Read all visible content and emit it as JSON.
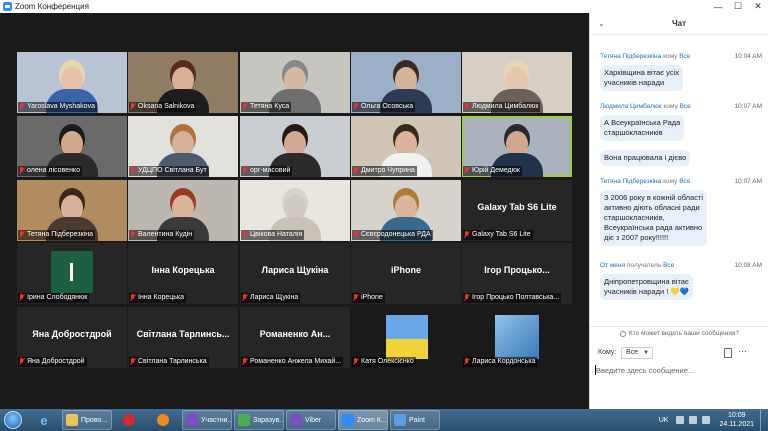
{
  "window": {
    "title": "Zoom Конференция",
    "controls": [
      "—",
      "☐",
      "✕"
    ]
  },
  "participants": [
    {
      "name": "Yaroslava Myshakova",
      "video": true,
      "muted": true,
      "bg": "#b8c3d4",
      "skin": "#e8c2a8",
      "shirt": "#3a63a8",
      "hair": "#e8d8a8"
    },
    {
      "name": "Oksana Salnikova",
      "video": true,
      "muted": true,
      "bg": "#8f7c62",
      "skin": "#d8b096",
      "shirt": "#1d1d1d",
      "hair": "#5a2b1a"
    },
    {
      "name": "Тетяна Куса",
      "video": true,
      "muted": true,
      "bg": "#c7c5c0",
      "skin": "#d4b8a4",
      "shirt": "#6e6e6e",
      "hair": "#888"
    },
    {
      "name": "Ольга Осовська",
      "video": true,
      "muted": true,
      "bg": "#9bb0c6",
      "skin": "#d5b39b",
      "shirt": "#2d3b55",
      "hair": "#3b2a22"
    },
    {
      "name": "Людмила Цимбалюк",
      "video": true,
      "muted": true,
      "bg": "#d8cfc4",
      "skin": "#e6c6ae",
      "shirt": "#6a6058",
      "hair": "#e4d6b8"
    },
    {
      "name": "олена лісовенко",
      "video": true,
      "muted": true,
      "bg": "#6a6a6a",
      "skin": "#d1a88c",
      "shirt": "#2a2a2a",
      "hair": "#1a1a1a"
    },
    {
      "name": "УДЦПО Світлана Бут",
      "video": true,
      "muted": true,
      "bg": "#e3e1dc",
      "skin": "#d5b09a",
      "shirt": "#4e5a6e",
      "hair": "#b07040"
    },
    {
      "name": "орг-масовий",
      "video": true,
      "muted": true,
      "bg": "#c9cdd2",
      "skin": "#d3a994",
      "shirt": "#2b2b2b",
      "hair": "#241812"
    },
    {
      "name": "Дмитро Чуприна",
      "video": true,
      "muted": true,
      "bg": "#cfc6b7",
      "skin": "#d9b49a",
      "shirt": "#f0f0f0",
      "hair": "#3a2a1e"
    },
    {
      "name": "Юрій Демедюк",
      "video": true,
      "muted": false,
      "speaking": true,
      "bg": "#a9b2bd",
      "skin": "#d2a790",
      "shirt": "#22324a",
      "hair": "#2a2a2a"
    },
    {
      "name": "Тетяна Підберезкіна",
      "video": true,
      "muted": true,
      "bg": "#b08c5e",
      "skin": "#d7b29a",
      "shirt": "#4a3b2e",
      "hair": "#3a281c"
    },
    {
      "name": "Валентина Кудін",
      "video": true,
      "muted": true,
      "bg": "#bcb7b0",
      "skin": "#d9b39a",
      "shirt": "#3a3a3a",
      "hair": "#9a3a22"
    },
    {
      "name": "Цвікова Наталія",
      "video": true,
      "muted": true,
      "bg": "#e9e6e0",
      "skin": "#cfcac2",
      "shirt": "#c8c2b8",
      "hair": "#d8d2c8"
    },
    {
      "name": "Сєвєродонецька РДА",
      "video": true,
      "muted": true,
      "bg": "#d6d2cc",
      "skin": "#dcb69c",
      "shirt": "#3a6a8a",
      "hair": "#b07a3a"
    },
    {
      "name": "Galaxy Tab S6 Lite",
      "display": "Galaxy Tab S6 Lite",
      "video": false,
      "muted": true
    },
    {
      "name": "Ірина Слободянюк",
      "video": false,
      "muted": true,
      "green": true
    },
    {
      "name": "Інна Корецька",
      "display": "Інна Корецька",
      "video": false,
      "muted": true
    },
    {
      "name": "Лариса Щукіна",
      "display": "Лариса Щукіна",
      "video": false,
      "muted": true
    },
    {
      "name": "iPhone",
      "display": "iPhone",
      "video": false,
      "muted": true
    },
    {
      "name": "Ігор Процько Полтавська...",
      "display": "Ігор Процько...",
      "video": false,
      "muted": true
    },
    {
      "name": "Яна Добростдрой",
      "display": "Яна Добростдрой",
      "video": false,
      "muted": true
    },
    {
      "name": "Світлана Тарлинська",
      "display": "Світлана Тарлинсь...",
      "video": false,
      "muted": true
    },
    {
      "name": "Романенко Анжела Михай...",
      "display": "Романенко Ан...",
      "video": false,
      "muted": true
    },
    {
      "name": "Катя Олексієнко",
      "video": true,
      "muted": true,
      "poster": "yellow-flower",
      "bg": "#1a1a1a"
    },
    {
      "name": "Лариса Кордонська",
      "video": true,
      "muted": true,
      "poster": "blue-photo",
      "bg": "#1a1a1a"
    }
  ],
  "chat": {
    "title": "Чат",
    "collapse_icon": "chevron-down-icon",
    "messages": [
      {
        "from": "Тетяна Підберезкіна",
        "to_word": "кому",
        "to": "Все",
        "time": "10:04 AM",
        "lines": [
          "Харківщина вітає усіх",
          "учасників наради"
        ]
      },
      {
        "from": "Людмила Цимбалюк",
        "to_word": "кому",
        "to": "Все",
        "time": "10:07 AM",
        "lines": [
          "А Всеукраїнська Рада",
          "старшокласників"
        ]
      },
      {
        "from": "",
        "to_word": "",
        "to": "",
        "time": "",
        "lines": [
          "Вона працювала і дієво"
        ]
      },
      {
        "from": "Тетяна Підберезкіна",
        "to_word": "кому",
        "to": "Все",
        "time": "10:07 AM",
        "lines": [
          "З 2006 року в кожній області",
          "активно діють обласні ради",
          "старшокласників,",
          "Всеукраїнська рада активно",
          "діє з 2007 року!!!!!!"
        ]
      },
      {
        "from": "От меня",
        "to_word": "получатель",
        "to": "Все",
        "time": "10:08 AM",
        "lines": [
          "Дніпропетровщина вітає",
          "учасників наради ! 💛💙"
        ]
      }
    ],
    "visibility_note": "Кто может видеть ваши сообщения?",
    "to_label": "Кому:",
    "recipient": "Все",
    "input_placeholder": "Введите здесь сообщение..."
  },
  "taskbar": {
    "tasks": [
      {
        "label": "Прово...",
        "icon": "folder-icon",
        "color": "#e8c35a"
      },
      {
        "label": "",
        "icon": "opera-icon",
        "color": "#d42b2b"
      },
      {
        "label": "",
        "icon": "vlc-icon",
        "color": "#f08a1c"
      },
      {
        "label": "Участни...",
        "icon": "viber-icon",
        "color": "#7b4fc4"
      },
      {
        "label": "Заразув...",
        "icon": "chrome-icon",
        "color": "#4caf50"
      },
      {
        "label": "Viber",
        "icon": "viber-icon",
        "color": "#7b4fc4"
      },
      {
        "label": "Zoom К...",
        "icon": "zoom-icon",
        "color": "#2d8cff",
        "active": true
      },
      {
        "label": "Paint",
        "icon": "paint-icon",
        "color": "#5aa0e0"
      }
    ],
    "language": "UK",
    "time": "10:09",
    "date": "24.11.2021"
  }
}
